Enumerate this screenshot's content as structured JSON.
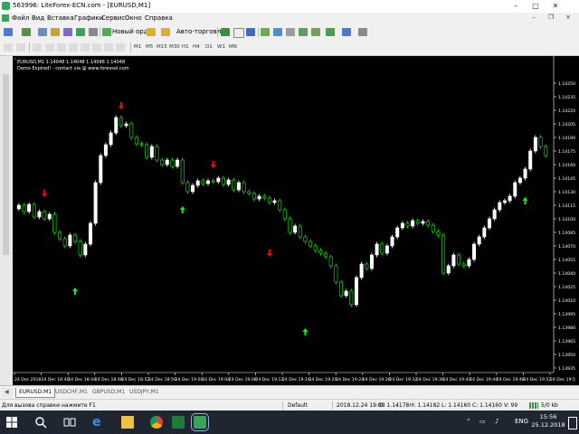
{
  "window": {
    "title": "563996: LiteForex-ECN.com - [EURUSD,M1]"
  },
  "menu": [
    "Файл",
    "Вид",
    "Вставка",
    "Графики",
    "Сервис",
    "Окно",
    "Справка"
  ],
  "toolbar": {
    "new_order_label": "Новый ордер",
    "autotrading_label": "Авто-торговля",
    "timeframes": [
      "M1",
      "M5",
      "M15",
      "M30",
      "H1",
      "H4",
      "D1",
      "W1",
      "MN"
    ]
  },
  "chart": {
    "header": "EURUSD,M1  1.14048 1.14048 1.14048 1.14048",
    "demo_note": "Demo Expired! - contact via @ www.forexsol.com",
    "bg_color": "#000000",
    "bull_color": "#ffffff",
    "bear_color": "#00ff00",
    "up_arrow_color": "#00ff00",
    "down_arrow_color": "#ff0000"
  },
  "chart_data": {
    "type": "candlestick",
    "symbol": "EURUSD",
    "timeframe": "M1",
    "ylim": [
      1.1393,
      1.1428
    ],
    "y_ticks": [
      "1.14250",
      "1.14235",
      "1.14220",
      "1.14205",
      "1.14190",
      "1.14175",
      "1.14160",
      "1.14145",
      "1.14130",
      "1.14115",
      "1.14100",
      "1.14085",
      "1.14070",
      "1.14055",
      "1.14040",
      "1.14025",
      "1.14010",
      "1.13995",
      "1.13980",
      "1.13965",
      "1.13950",
      "1.13935"
    ],
    "x_ticks": [
      "24 Dec 2018",
      "24 Dec 18:40",
      "24 Dec 18:44",
      "24 Dec 18:48",
      "24 Dec 18:52",
      "24 Dec 18:56",
      "24 Dec 19:00",
      "24 Dec 19:04",
      "24 Dec 19:08",
      "24 Dec 19:12",
      "24 Dec 19:16",
      "24 Dec 19:20",
      "24 Dec 19:24",
      "24 Dec 19:28",
      "24 Dec 19:32",
      "24 Dec 19:36",
      "24 Dec 19:40",
      "24 Dec 19:44",
      "24 Dec 19:48",
      "24 Dec 19:52",
      "24 Dec 19:5"
    ],
    "closes": [
      1.14115,
      1.14108,
      1.14116,
      1.14102,
      1.14108,
      1.141,
      1.14105,
      1.14085,
      1.14078,
      1.1407,
      1.14082,
      1.14075,
      1.1406,
      1.14072,
      1.14095,
      1.1414,
      1.1417,
      1.14182,
      1.14195,
      1.14212,
      1.14203,
      1.14205,
      1.1419,
      1.14183,
      1.14182,
      1.14168,
      1.1418,
      1.14165,
      1.1416,
      1.14165,
      1.14158,
      1.14165,
      1.1414,
      1.1413,
      1.14137,
      1.14142,
      1.14139,
      1.14142,
      1.14141,
      1.14145,
      1.14138,
      1.14143,
      1.14132,
      1.1414,
      1.1413,
      1.14128,
      1.14122,
      1.14125,
      1.14123,
      1.14118,
      1.1412,
      1.1411,
      1.141,
      1.14085,
      1.14092,
      1.1408,
      1.14075,
      1.1407,
      1.14065,
      1.14062,
      1.14058,
      1.14048,
      1.1403,
      1.14015,
      1.1402,
      1.14005,
      1.14035,
      1.1405,
      1.14045,
      1.1406,
      1.14072,
      1.14062,
      1.1407,
      1.1408,
      1.1409,
      1.14095,
      1.14092,
      1.14098,
      1.14095,
      1.14097,
      1.14093,
      1.14086,
      1.14082,
      1.1404,
      1.14048,
      1.1406,
      1.1405,
      1.14048,
      1.14055,
      1.14072,
      1.1408,
      1.1409,
      1.141,
      1.1411,
      1.14118,
      1.1412,
      1.14125,
      1.1414,
      1.14145,
      1.14155,
      1.14175,
      1.1419,
      1.1418,
      1.1417
    ],
    "signals": [
      {
        "index": 5,
        "type": "sell",
        "price": 1.14128
      },
      {
        "index": 11,
        "type": "buy",
        "price": 1.1402
      },
      {
        "index": 20,
        "type": "sell",
        "price": 1.14225
      },
      {
        "index": 32,
        "type": "buy",
        "price": 1.1411
      },
      {
        "index": 38,
        "type": "sell",
        "price": 1.1416
      },
      {
        "index": 49,
        "type": "sell",
        "price": 1.14062
      },
      {
        "index": 56,
        "type": "buy",
        "price": 1.13975
      },
      {
        "index": 99,
        "type": "buy",
        "price": 1.1412
      }
    ]
  },
  "tabs": [
    "EURUSD,M1",
    "USDCHF,M1",
    "GBPUSD,M1",
    "USDJPY,M1"
  ],
  "status": {
    "help": "Для вызова справки нажмите F1",
    "profile": "Default",
    "datetime": "2018.12.24 19:00",
    "open": "O: 1.14178",
    "high": "H: 1.14182",
    "low": "L: 1.14160",
    "close": "C: 1.14160",
    "volume": "V: 99",
    "traffic": "5/0 kb"
  },
  "taskbar": {
    "language": "ENG",
    "time": "15:56",
    "date": "25.12.2018"
  }
}
